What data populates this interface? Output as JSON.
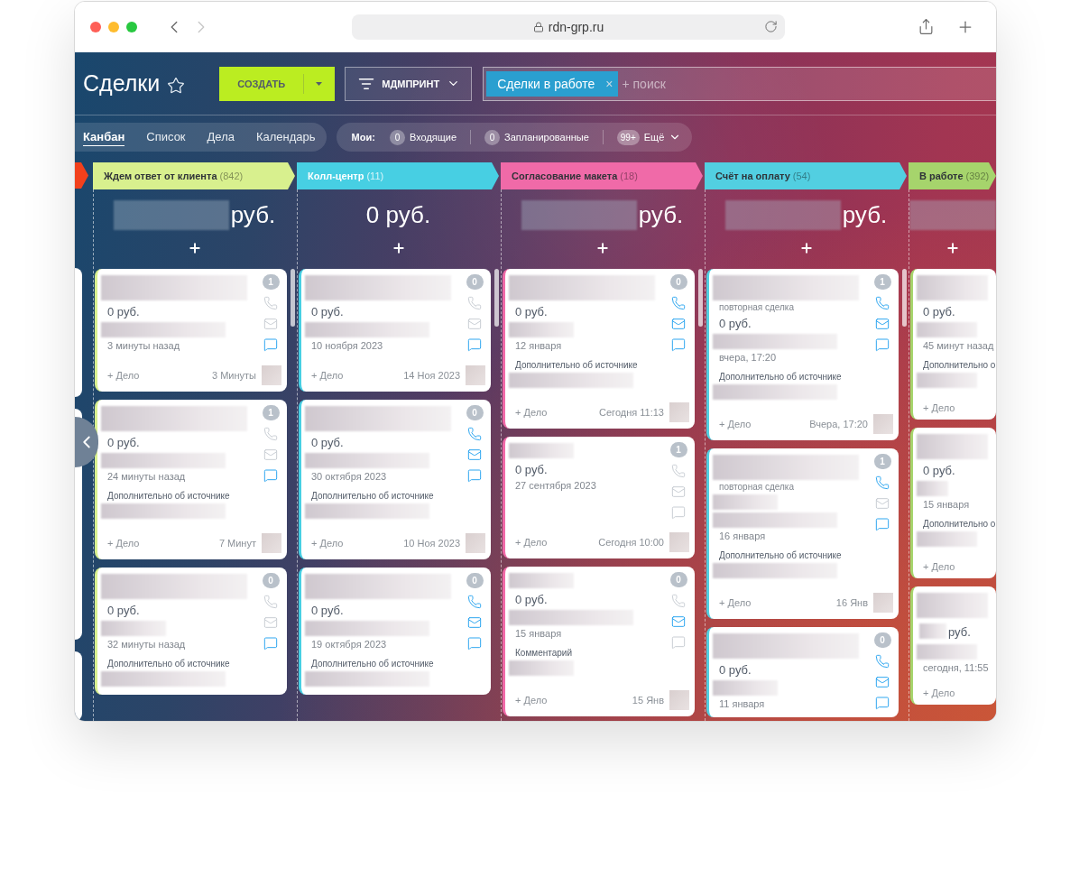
{
  "browser": {
    "url": "rdn-grp.ru"
  },
  "header": {
    "title": "Сделки",
    "create_button": "СОЗДАТЬ",
    "filter_button": "МДМПРИНТ",
    "search": {
      "tag": "Сделки в работе",
      "tag_close": "×",
      "placeholder": "+ поиск"
    }
  },
  "views": [
    {
      "label": "Канбан",
      "selected": true
    },
    {
      "label": "Список",
      "selected": false
    },
    {
      "label": "Дела",
      "selected": false
    },
    {
      "label": "Календарь",
      "selected": false
    }
  ],
  "counters": {
    "label": "Мои:",
    "items": [
      {
        "count": "0",
        "label": "Входящие",
        "kind": "plain"
      },
      {
        "count": "0",
        "label": "Запланированные",
        "kind": "plain"
      },
      {
        "count": "99+",
        "label": "Ещё",
        "kind": "more"
      }
    ]
  },
  "cut_column": {
    "color": "#f2401c"
  },
  "columns": [
    {
      "name": "Ждем ответ от клиента",
      "count": "(842)",
      "color": "#d8f08e",
      "light_text": false,
      "sum": {
        "redacted": true,
        "text": "руб."
      },
      "cards": [
        {
          "count": "1",
          "phone": false,
          "mail": false,
          "chat": true,
          "lines": [
            {
              "kind": "redacted_title"
            },
            {
              "kind": "price",
              "text": "0 руб."
            },
            {
              "kind": "redacted"
            },
            {
              "kind": "date",
              "text": "3 минуты назад"
            }
          ],
          "footer": {
            "add": "+ Дело",
            "time": "3 Минуты"
          }
        },
        {
          "count": "1",
          "phone": false,
          "mail": false,
          "chat": true,
          "lines": [
            {
              "kind": "redacted_title"
            },
            {
              "kind": "price",
              "text": "0 руб."
            },
            {
              "kind": "redacted"
            },
            {
              "kind": "date",
              "text": "24 минуты назад"
            },
            {
              "kind": "field_label",
              "text": "Дополнительно об источнике"
            },
            {
              "kind": "redacted"
            }
          ],
          "footer": {
            "add": "+ Дело",
            "time": "7 Минут"
          }
        },
        {
          "count": "0",
          "phone": false,
          "mail": false,
          "chat": true,
          "lines": [
            {
              "kind": "redacted_title"
            },
            {
              "kind": "price",
              "text": "0 руб."
            },
            {
              "kind": "redacted_short"
            },
            {
              "kind": "date",
              "text": "32 минуты назад"
            },
            {
              "kind": "field_label",
              "text": "Дополнительно об источнике"
            },
            {
              "kind": "redacted"
            }
          ]
        }
      ]
    },
    {
      "name": "Колл-центр",
      "count": "(11)",
      "color": "#47cfe3",
      "light_text": true,
      "sum": {
        "redacted": false,
        "text": "0 руб."
      },
      "cards": [
        {
          "count": "0",
          "phone": false,
          "mail": false,
          "chat": true,
          "lines": [
            {
              "kind": "redacted_title"
            },
            {
              "kind": "price",
              "text": "0 руб."
            },
            {
              "kind": "redacted"
            },
            {
              "kind": "date",
              "text": "10 ноября 2023"
            }
          ],
          "footer": {
            "add": "+ Дело",
            "time": "14 Ноя 2023"
          }
        },
        {
          "count": "0",
          "phone": true,
          "mail": true,
          "chat": true,
          "lines": [
            {
              "kind": "redacted_title"
            },
            {
              "kind": "price",
              "text": "0 руб."
            },
            {
              "kind": "redacted"
            },
            {
              "kind": "date",
              "text": "30 октября 2023"
            },
            {
              "kind": "field_label",
              "text": "Дополнительно об источнике"
            },
            {
              "kind": "redacted"
            }
          ],
          "footer": {
            "add": "+ Дело",
            "time": "10 Ноя 2023"
          }
        },
        {
          "count": "0",
          "phone": true,
          "mail": true,
          "chat": true,
          "lines": [
            {
              "kind": "redacted_title"
            },
            {
              "kind": "price",
              "text": "0 руб."
            },
            {
              "kind": "redacted"
            },
            {
              "kind": "date",
              "text": "19 октября 2023"
            },
            {
              "kind": "field_label",
              "text": "Дополнительно об источнике"
            },
            {
              "kind": "redacted"
            }
          ]
        }
      ]
    },
    {
      "name": "Согласование макета",
      "count": "(18)",
      "color": "#f06aa8",
      "light_text": false,
      "sum": {
        "redacted": true,
        "text": "руб."
      },
      "cards": [
        {
          "count": "0",
          "phone": true,
          "mail": true,
          "chat": true,
          "lines": [
            {
              "kind": "redacted_title"
            },
            {
              "kind": "price",
              "text": "0 руб."
            },
            {
              "kind": "redacted_short"
            },
            {
              "kind": "date",
              "text": "12 января"
            },
            {
              "kind": "field_label",
              "text": "Дополнительно об источнике"
            },
            {
              "kind": "redacted"
            }
          ],
          "footer": {
            "add": "+ Дело",
            "time": "Сегодня 11:13"
          }
        },
        {
          "count": "1",
          "phone": false,
          "mail": false,
          "chat": false,
          "lines": [
            {
              "kind": "redacted_short"
            },
            {
              "kind": "price",
              "text": "0 руб."
            },
            {
              "kind": "date",
              "text": "27 сентября 2023"
            }
          ],
          "footer": {
            "add": "+ Дело",
            "time": "Сегодня 10:00"
          }
        },
        {
          "count": "0",
          "phone": false,
          "mail": true,
          "chat": false,
          "lines": [
            {
              "kind": "redacted_short"
            },
            {
              "kind": "price",
              "text": "0 руб."
            },
            {
              "kind": "redacted"
            },
            {
              "kind": "date",
              "text": "15 января"
            },
            {
              "kind": "field_label",
              "text": "Комментарий"
            },
            {
              "kind": "redacted_short"
            }
          ],
          "footer": {
            "add": "+ Дело",
            "time": "15 Янв"
          }
        }
      ]
    },
    {
      "name": "Счёт на оплату",
      "count": "(54)",
      "color": "#52cfe1",
      "light_text": false,
      "sum": {
        "redacted": true,
        "text": "руб."
      },
      "cards": [
        {
          "count": "1",
          "phone": true,
          "mail": true,
          "chat": true,
          "lines": [
            {
              "kind": "redacted_title"
            },
            {
              "kind": "tag",
              "text": "повторная сделка"
            },
            {
              "kind": "price",
              "text": "0 руб."
            },
            {
              "kind": "redacted"
            },
            {
              "kind": "date",
              "text": "вчера, 17:20"
            },
            {
              "kind": "field_label",
              "text": "Дополнительно об источнике"
            },
            {
              "kind": "redacted"
            }
          ],
          "footer": {
            "add": "+ Дело",
            "time": "Вчера, 17:20"
          }
        },
        {
          "count": "1",
          "phone": true,
          "mail": false,
          "chat": true,
          "lines": [
            {
              "kind": "redacted_title"
            },
            {
              "kind": "tag",
              "text": "повторная сделка"
            },
            {
              "kind": "redacted_short"
            },
            {
              "kind": "redacted"
            },
            {
              "kind": "date",
              "text": "16 января"
            },
            {
              "kind": "field_label",
              "text": "Дополнительно об источнике"
            },
            {
              "kind": "redacted"
            }
          ],
          "footer": {
            "add": "+ Дело",
            "time": "16 Янв"
          }
        },
        {
          "count": "0",
          "phone": true,
          "mail": true,
          "chat": true,
          "lines": [
            {
              "kind": "redacted_title"
            },
            {
              "kind": "price",
              "text": "0 руб."
            },
            {
              "kind": "redacted_short"
            },
            {
              "kind": "date",
              "text": "11 января"
            }
          ]
        }
      ]
    },
    {
      "name": "В работе",
      "count": "(392)",
      "color": "#a6d46c",
      "light_text": false,
      "sum": {
        "redacted": true
      },
      "cards": [
        {
          "lines": [
            {
              "kind": "redacted_title"
            },
            {
              "kind": "price",
              "text": "0 руб."
            },
            {
              "kind": "redacted"
            },
            {
              "kind": "date",
              "text": "45 минут назад"
            },
            {
              "kind": "field_label",
              "text": "Дополнительно о"
            },
            {
              "kind": "redacted"
            }
          ],
          "footer": {
            "add": "+ Дело"
          }
        },
        {
          "lines": [
            {
              "kind": "redacted_title"
            },
            {
              "kind": "price",
              "text": "0 руб."
            },
            {
              "kind": "redacted_short"
            },
            {
              "kind": "date",
              "text": "15 января"
            },
            {
              "kind": "field_label",
              "text": "Дополнительно о"
            },
            {
              "kind": "redacted"
            }
          ],
          "footer": {
            "add": "+ Дело"
          }
        },
        {
          "lines": [
            {
              "kind": "redacted_title"
            },
            {
              "kind": "redacted_price",
              "text": "руб."
            },
            {
              "kind": "redacted"
            },
            {
              "kind": "date",
              "text": "сегодня, 11:55"
            }
          ],
          "footer": {
            "add": "+ Дело"
          }
        }
      ]
    }
  ]
}
